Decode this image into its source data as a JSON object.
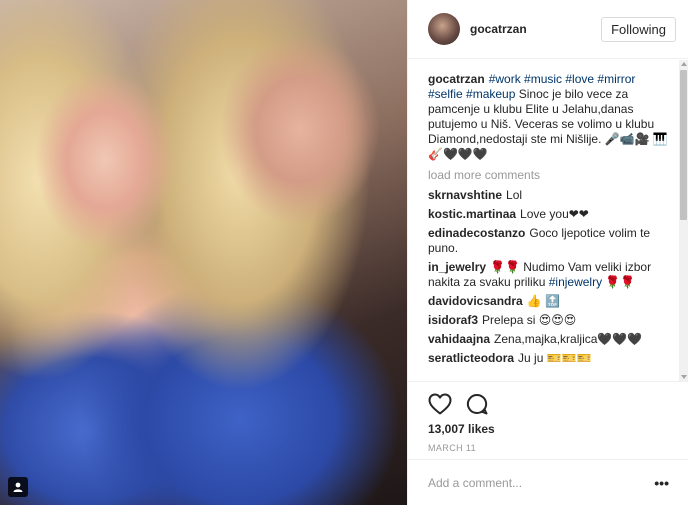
{
  "post": {
    "username": "gocatrzan",
    "follow_label": "Following"
  },
  "caption": {
    "user": "gocatrzan",
    "hashtags": "#work #music #love #mirror #selfie #makeup",
    "text": "Sinoc je bilo vece za pamcenje u klubu Elite u Jelahu,danas putujemo u Niš. Veceras se volimo u klubu Diamond,nedostaji ste mi Nišlije. 🎤📹🎥 🎹🎸🖤🖤🖤"
  },
  "load_more": "load more comments",
  "comments": [
    {
      "user": "skrnavshtine",
      "text": "Lol"
    },
    {
      "user": "kostic.martinaa",
      "text": "Love you❤❤"
    },
    {
      "user": "edinadecostanzo",
      "text": "Goco ljepotice volim te puno."
    },
    {
      "user": "in_jewelry",
      "text": "🌹🌹 Nudimo Vam veliki izbor nakita za svaku priliku",
      "tag": "#injewelry",
      "suffix": " 🌹🌹"
    },
    {
      "user": "davidovicsandra",
      "text": "👍 🔝"
    },
    {
      "user": "isidoraf3",
      "text": "Prelepa si 😍😍😍"
    },
    {
      "user": "vahidaajna",
      "text": "Zena,majka,kraljica🖤🖤🖤"
    },
    {
      "user": "seratlicteodora",
      "text": "Ju ju 🎫🎫🎫"
    }
  ],
  "likes": "13,007 likes",
  "date": "MARCH 11",
  "add_comment_placeholder": "Add a comment...",
  "more_label": "•••",
  "icons": {
    "heart": "heart-icon",
    "comment": "comment-icon",
    "photo_tag": "person-tag-icon",
    "more": "more-options-icon"
  },
  "colors": {
    "hashtag": "#003569",
    "muted": "#999999",
    "border": "#efefef"
  }
}
